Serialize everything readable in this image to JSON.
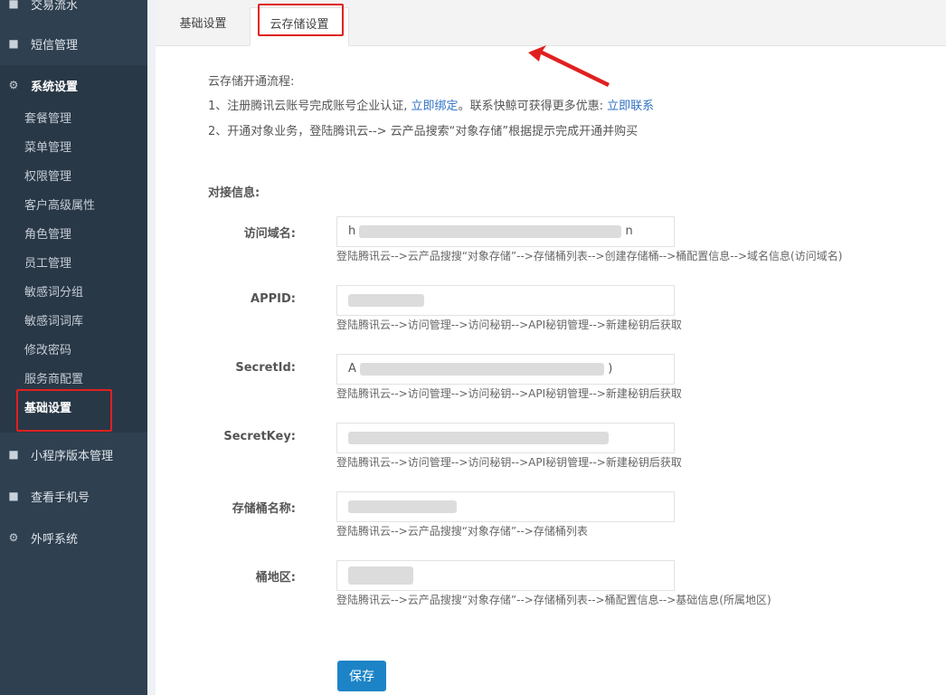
{
  "sidebar": {
    "items": [
      {
        "label": "交易流水",
        "icon": "book-icon"
      },
      {
        "label": "短信管理",
        "icon": "book-icon"
      },
      {
        "label": "系统设置",
        "icon": "gear-icon"
      },
      {
        "label": "小程序版本管理",
        "icon": "book-icon"
      },
      {
        "label": "查看手机号",
        "icon": "book-icon"
      },
      {
        "label": "外呼系统",
        "icon": "gear-icon"
      }
    ],
    "sub_items": [
      "套餐管理",
      "菜单管理",
      "权限管理",
      "客户高级属性",
      "角色管理",
      "员工管理",
      "敏感词分组",
      "敏感词词库",
      "修改密码",
      "服务商配置",
      "基础设置"
    ]
  },
  "tabs": [
    "基础设置",
    "云存储设置"
  ],
  "intro": {
    "title": "云存储开通流程:",
    "step1_text": "1、注册腾讯云账号完成账号企业认证, ",
    "step1_link": "立即绑定",
    "step1_mid": "。联系快鲸可获得更多优惠: ",
    "step1_link2": "立即联系",
    "step2": "2、开通对象业务，登陆腾讯云--> 云产品搜索“对象存储”根据提示完成开通并购买"
  },
  "section_title": "对接信息:",
  "fields": [
    {
      "label": "访问域名:",
      "value_start": "h",
      "value_end": "n",
      "hint": "登陆腾讯云-->云产品搜搜“对象存储”-->存储桶列表-->创建存储桶-->桶配置信息-->域名信息(访问域名)"
    },
    {
      "label": "APPID:",
      "value_start": "",
      "value_end": "",
      "hint": "登陆腾讯云-->访问管理-->访问秘钥-->API秘钥管理-->新建秘钥后获取"
    },
    {
      "label": "SecretId:",
      "value_start": "A",
      "value_end": ")",
      "hint": "登陆腾讯云-->访问管理-->访问秘钥-->API秘钥管理-->新建秘钥后获取"
    },
    {
      "label": "SecretKey:",
      "value_start": "",
      "value_end": "",
      "hint": "登陆腾讯云-->访问管理-->访问秘钥-->API秘钥管理-->新建秘钥后获取"
    },
    {
      "label": "存储桶名称:",
      "value_start": "",
      "value_end": "",
      "hint": "登陆腾讯云-->云产品搜搜“对象存储”-->存储桶列表"
    },
    {
      "label": "桶地区:",
      "value_start": "",
      "value_end": "",
      "hint": "登陆腾讯云-->云产品搜搜“对象存储”-->存储桶列表-->桶配置信息-->基础信息(所属地区)"
    }
  ],
  "save_label": "保存",
  "colors": {
    "sidebar": "#2f4050",
    "highlight": "#e02020",
    "link": "#2f72c4",
    "button": "#1c84c6"
  }
}
